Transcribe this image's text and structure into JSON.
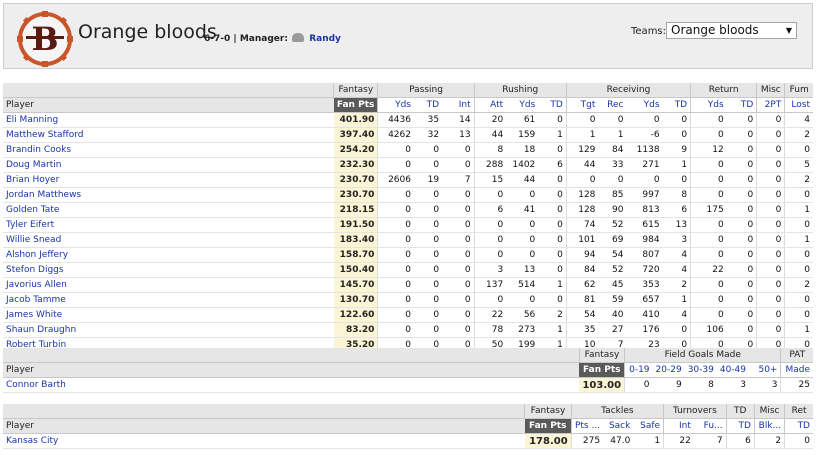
{
  "team": {
    "name": "Orange bloods",
    "record": "6-7-0",
    "manager_label": "Manager:",
    "manager": "Randy",
    "teams_label": "Teams:",
    "teams_selected": "Orange bloods"
  },
  "offense": {
    "groups": [
      "Fantasy",
      "Passing",
      "Rushing",
      "Receiving",
      "Return",
      "Misc",
      "Fum"
    ],
    "player_header": "Player",
    "columns": [
      "Fan Pts",
      "Yds",
      "TD",
      "Int",
      "Att",
      "Yds",
      "TD",
      "Tgt",
      "Rec",
      "Yds",
      "TD",
      "Yds",
      "TD",
      "2PT",
      "Lost"
    ],
    "rows": [
      {
        "name": "Eli Manning",
        "pts": "401.90",
        "v": [
          "4436",
          "35",
          "14",
          "20",
          "61",
          "0",
          "0",
          "0",
          "0",
          "0",
          "0",
          "0",
          "0",
          "4"
        ]
      },
      {
        "name": "Matthew Stafford",
        "pts": "397.40",
        "v": [
          "4262",
          "32",
          "13",
          "44",
          "159",
          "1",
          "1",
          "1",
          "-6",
          "0",
          "0",
          "0",
          "0",
          "2"
        ]
      },
      {
        "name": "Brandin Cooks",
        "pts": "254.20",
        "v": [
          "0",
          "0",
          "0",
          "8",
          "18",
          "0",
          "129",
          "84",
          "1138",
          "9",
          "12",
          "0",
          "0",
          "0"
        ]
      },
      {
        "name": "Doug Martin",
        "pts": "232.30",
        "v": [
          "0",
          "0",
          "0",
          "288",
          "1402",
          "6",
          "44",
          "33",
          "271",
          "1",
          "0",
          "0",
          "0",
          "5"
        ]
      },
      {
        "name": "Brian Hoyer",
        "pts": "230.70",
        "v": [
          "2606",
          "19",
          "7",
          "15",
          "44",
          "0",
          "0",
          "0",
          "0",
          "0",
          "0",
          "0",
          "0",
          "2"
        ]
      },
      {
        "name": "Jordan Matthews",
        "pts": "230.70",
        "v": [
          "0",
          "0",
          "0",
          "0",
          "0",
          "0",
          "128",
          "85",
          "997",
          "8",
          "0",
          "0",
          "0",
          "0"
        ]
      },
      {
        "name": "Golden Tate",
        "pts": "218.15",
        "v": [
          "0",
          "0",
          "0",
          "6",
          "41",
          "0",
          "128",
          "90",
          "813",
          "6",
          "175",
          "0",
          "0",
          "1"
        ]
      },
      {
        "name": "Tyler Eifert",
        "pts": "191.50",
        "v": [
          "0",
          "0",
          "0",
          "0",
          "0",
          "0",
          "74",
          "52",
          "615",
          "13",
          "0",
          "0",
          "0",
          "0"
        ]
      },
      {
        "name": "Willie Snead",
        "pts": "183.40",
        "v": [
          "0",
          "0",
          "0",
          "0",
          "0",
          "0",
          "101",
          "69",
          "984",
          "3",
          "0",
          "0",
          "0",
          "1"
        ]
      },
      {
        "name": "Alshon Jeffery",
        "pts": "158.70",
        "v": [
          "0",
          "0",
          "0",
          "0",
          "0",
          "0",
          "94",
          "54",
          "807",
          "4",
          "0",
          "0",
          "0",
          "0"
        ]
      },
      {
        "name": "Stefon Diggs",
        "pts": "150.40",
        "v": [
          "0",
          "0",
          "0",
          "3",
          "13",
          "0",
          "84",
          "52",
          "720",
          "4",
          "22",
          "0",
          "0",
          "0"
        ]
      },
      {
        "name": "Javorius Allen",
        "pts": "145.70",
        "v": [
          "0",
          "0",
          "0",
          "137",
          "514",
          "1",
          "62",
          "45",
          "353",
          "2",
          "0",
          "0",
          "0",
          "2"
        ]
      },
      {
        "name": "Jacob Tamme",
        "pts": "130.70",
        "v": [
          "0",
          "0",
          "0",
          "0",
          "0",
          "0",
          "81",
          "59",
          "657",
          "1",
          "0",
          "0",
          "0",
          "0"
        ]
      },
      {
        "name": "James White",
        "pts": "122.60",
        "v": [
          "0",
          "0",
          "0",
          "22",
          "56",
          "2",
          "54",
          "40",
          "410",
          "4",
          "0",
          "0",
          "0",
          "0"
        ]
      },
      {
        "name": "Shaun Draughn",
        "pts": "83.20",
        "v": [
          "0",
          "0",
          "0",
          "78",
          "273",
          "1",
          "35",
          "27",
          "176",
          "0",
          "106",
          "0",
          "0",
          "1"
        ]
      },
      {
        "name": "Robert Turbin",
        "pts": "35.20",
        "v": [
          "0",
          "0",
          "0",
          "50",
          "199",
          "1",
          "10",
          "7",
          "23",
          "0",
          "0",
          "0",
          "0",
          "0"
        ]
      }
    ]
  },
  "kicker": {
    "groups": [
      "Fantasy",
      "Field Goals Made",
      "PAT"
    ],
    "player_header": "Player",
    "columns": [
      "Fan Pts",
      "0-19",
      "20-29",
      "30-39",
      "40-49",
      "50+",
      "Made"
    ],
    "rows": [
      {
        "name": "Connor Barth",
        "pts": "103.00",
        "v": [
          "0",
          "9",
          "8",
          "3",
          "3",
          "25"
        ]
      }
    ]
  },
  "defense": {
    "groups": [
      "Fantasy",
      "Tackles",
      "Turnovers",
      "TD",
      "Misc",
      "Ret"
    ],
    "player_header": "Player",
    "columns": [
      "Fan Pts",
      "Pts ...",
      "Sack",
      "Safe",
      "Int",
      "Fu...",
      "TD",
      "Blk...",
      "TD"
    ],
    "rows": [
      {
        "name": "Kansas City",
        "pts": "178.00",
        "v": [
          "275",
          "47.0",
          "1",
          "22",
          "7",
          "6",
          "2",
          "0"
        ]
      }
    ]
  }
}
